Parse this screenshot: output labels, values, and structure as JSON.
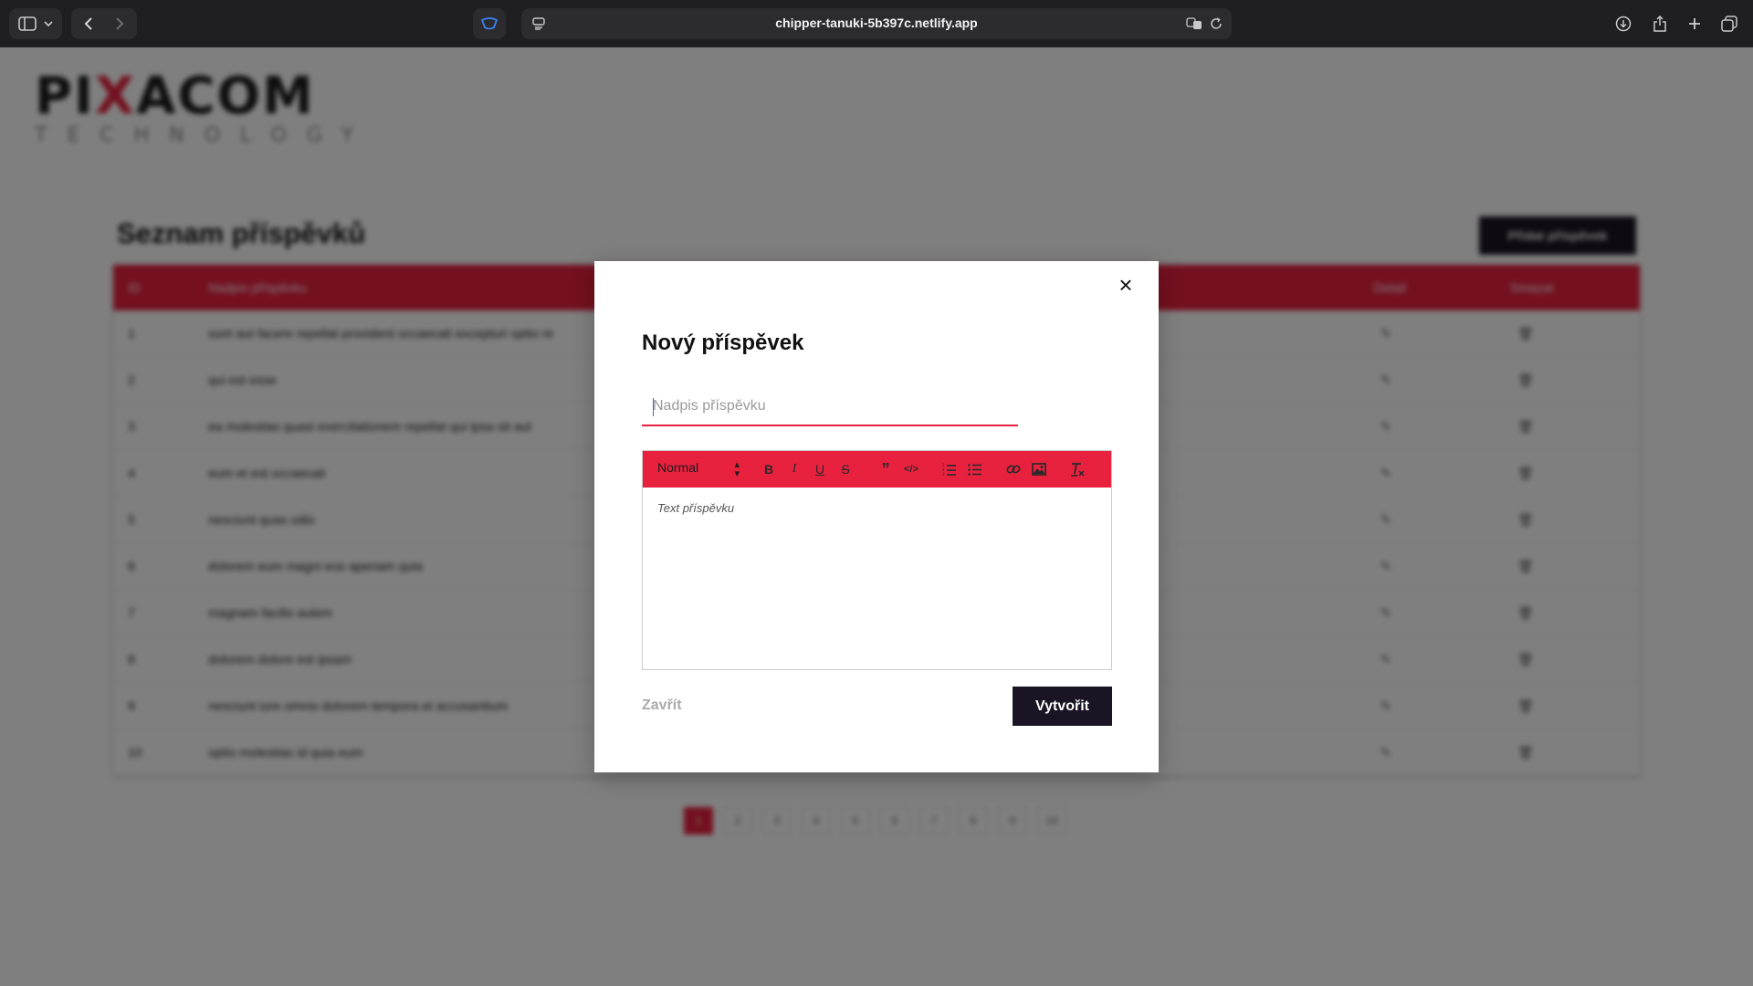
{
  "browser": {
    "url": "chipper-tanuki-5b397c.netlify.app",
    "icons": [
      "sidebar-icon",
      "chevron-down-icon",
      "back-icon",
      "forward-icon",
      "shield-icon",
      "page-menu-icon",
      "translate-icon",
      "reload-icon",
      "download-icon",
      "share-icon",
      "plus-icon",
      "tabs-icon"
    ]
  },
  "logo": {
    "main_left": "PI",
    "main_x": "X",
    "main_right": "ACOM",
    "sub": "TECHNOLOGY"
  },
  "page": {
    "title": "Seznam příspěvků",
    "add_button": "Přidat příspěvek",
    "columns": {
      "id": "ID",
      "title": "Nadpis příspěvku",
      "detail": "Detail",
      "delete": "Smazat"
    },
    "rows": [
      {
        "id": "1",
        "title": "sunt aut facere repellat provident occaecati excepturi optio re"
      },
      {
        "id": "2",
        "title": "qui est esse"
      },
      {
        "id": "3",
        "title": "ea molestias quasi exercitationem repellat qui ipsa sit aut"
      },
      {
        "id": "4",
        "title": "eum et est occaecati"
      },
      {
        "id": "5",
        "title": "nesciunt quas odio"
      },
      {
        "id": "6",
        "title": "dolorem eum magni eos aperiam quia"
      },
      {
        "id": "7",
        "title": "magnam facilis autem"
      },
      {
        "id": "8",
        "title": "dolorem dolore est ipsam"
      },
      {
        "id": "9",
        "title": "nesciunt iure omnis dolorem tempora et accusantium"
      },
      {
        "id": "10",
        "title": "optio molestias id quia eum"
      }
    ],
    "pages": [
      "1",
      "2",
      "3",
      "4",
      "5",
      "6",
      "7",
      "8",
      "9",
      "10"
    ],
    "active_page": "1"
  },
  "modal": {
    "close_icon": "×",
    "title": "Nový příspěvek",
    "title_placeholder": "Nadpis příspěvku",
    "editor": {
      "format_select": "Normal",
      "placeholder": "Text příspěvku",
      "tools": [
        "bold-icon",
        "italic-icon",
        "underline-icon",
        "strike-icon",
        "blockquote-icon",
        "code-icon",
        "ordered-list-icon",
        "bullet-list-icon",
        "link-icon",
        "image-icon",
        "clear-format-icon"
      ]
    },
    "close_label": "Zavřít",
    "create_label": "Vytvořit"
  },
  "colors": {
    "accent": "#e8213f",
    "dark_button": "#1a1424",
    "browser_bar": "#1f1f21"
  }
}
